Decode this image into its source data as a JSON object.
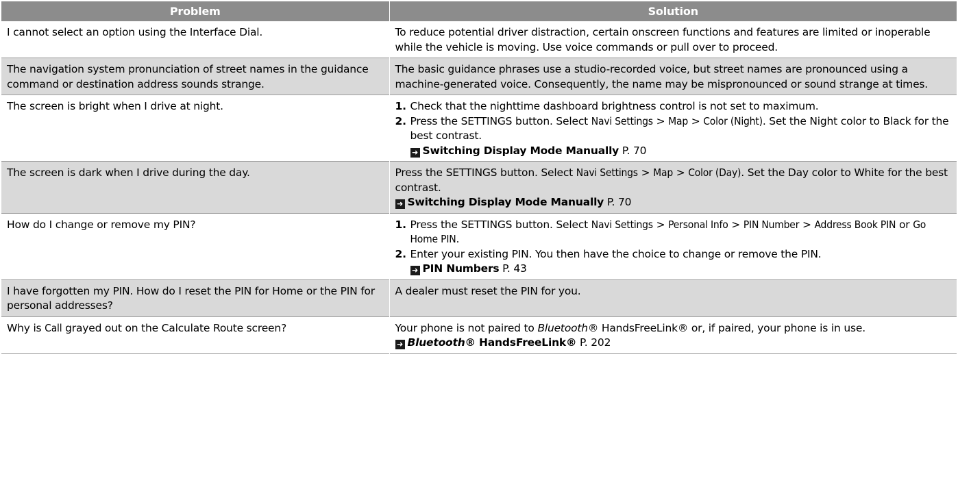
{
  "headers": {
    "problem": "Problem",
    "solution": "Solution"
  },
  "rows": [
    {
      "problem": "I cannot select an option using the Interface Dial.",
      "solution": "To reduce potential driver distraction, certain onscreen functions and features are limited or inoperable while the vehicle is moving. Use voice commands or pull over to proceed."
    },
    {
      "problem": "The navigation system pronunciation of street names in the guidance command or destination address sounds strange.",
      "solution": "The basic guidance phrases use a studio-recorded voice, but street names are pronounced using a machine-generated voice. Consequently, the name may be mispronounced or sound strange at times."
    },
    {
      "problem": "The screen is bright when I drive at night.",
      "step1_num": "1.",
      "step1_text": "Check that the nighttime dashboard brightness control is not set to maximum.",
      "step2_num": "2.",
      "step2_a": "Press the SETTINGS button. Select ",
      "step2_ui1": "Navi Settings",
      "step2_sep1": " > ",
      "step2_ui2": "Map",
      "step2_sep2": " > ",
      "step2_ui3": "Color (Night)",
      "step2_b": ". Set the Night color to Black for the best contrast.",
      "ref_icon": "arrow-ref-icon",
      "ref_title": "Switching Display Mode Manually",
      "ref_page": " P. 70"
    },
    {
      "problem": "The screen is dark when I drive during the day.",
      "sol_a": "Press the SETTINGS button. Select ",
      "sol_ui1": "Navi Settings",
      "sol_sep1": " > ",
      "sol_ui2": "Map",
      "sol_sep2": " > ",
      "sol_ui3": "Color (Day)",
      "sol_b": ". Set the Day color to White for the best contrast.",
      "ref_icon": "arrow-ref-icon",
      "ref_title": "Switching Display Mode Manually",
      "ref_page": " P. 70"
    },
    {
      "problem": "How do I change or remove my PIN?",
      "step1_num": "1.",
      "step1_a": "Press the SETTINGS button. Select ",
      "step1_ui1": "Navi Settings",
      "step1_sep1": " > ",
      "step1_ui2": "Personal Info",
      "step1_sep2": " > ",
      "step1_ui3": "PIN Number",
      "step1_sep3": " > ",
      "step1_ui4": "Address Book PIN",
      "step1_or": " or ",
      "step1_ui5": "Go Home PIN",
      "step1_end": ".",
      "step2_num": "2.",
      "step2_text": "Enter your existing PIN. You then have the choice to change or remove the PIN.",
      "ref_icon": "arrow-ref-icon",
      "ref_title": "PIN Numbers",
      "ref_page": " P. 43"
    },
    {
      "problem": "I have forgotten my PIN. How do I reset the PIN for Home or the PIN for personal addresses?",
      "solution": "A dealer must reset the PIN for you."
    },
    {
      "problem_a": "Why is ",
      "problem_ui": "Call",
      "problem_b": " grayed out on the Calculate Route screen?",
      "sol_a": "Your phone is not paired to ",
      "sol_it": "Bluetooth",
      "sol_b": "® HandsFreeLink® or, if paired, your phone is in use.",
      "ref_icon": "arrow-ref-icon",
      "ref_title_it": "Bluetooth",
      "ref_title_rest": "® HandsFreeLink®",
      "ref_page": " P. 202"
    }
  ]
}
